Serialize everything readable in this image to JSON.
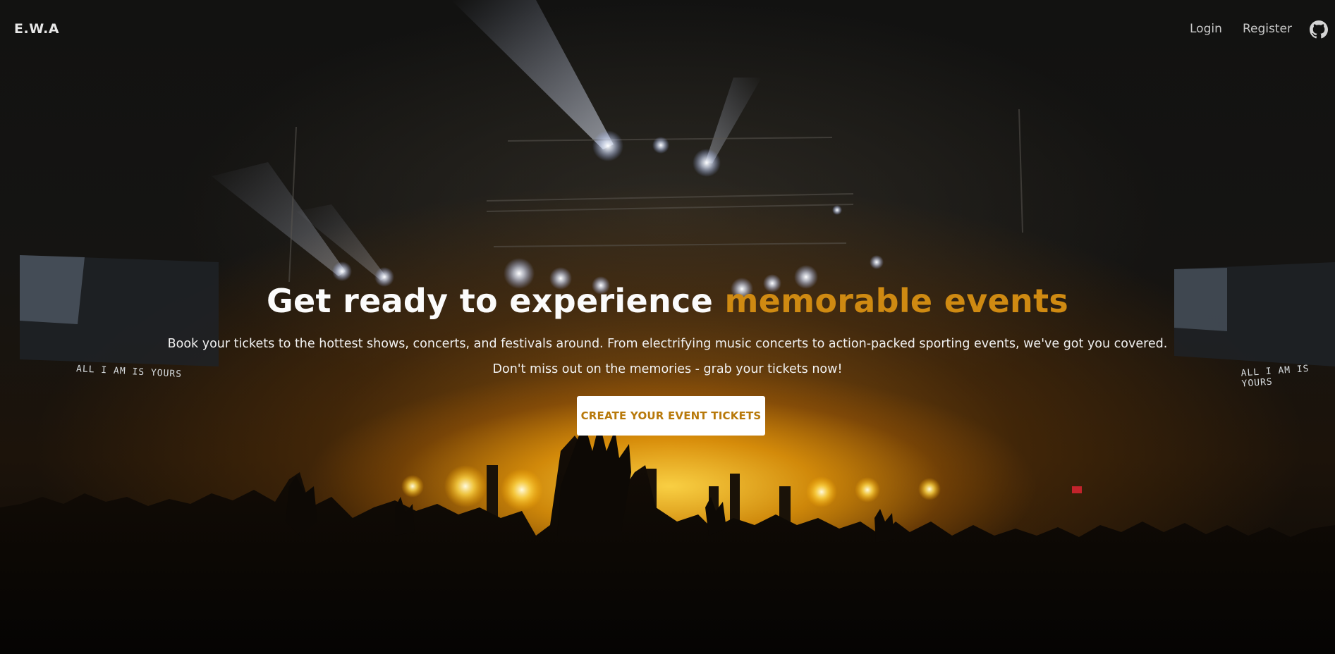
{
  "nav": {
    "brand": "E.W.A",
    "login_label": "Login",
    "register_label": "Register",
    "github_icon": "github-icon"
  },
  "hero": {
    "headline_main": "Get ready to experience ",
    "headline_accent": "memorable events",
    "subtitle_1": "Book your tickets to the hottest shows, concerts, and festivals around. From electrifying music concerts to action-packed sporting events, we've got you covered.",
    "subtitle_2": "Don't miss out on the memories - grab your tickets now!",
    "cta_label": "CREATE YOUR EVENT TICKETS",
    "screen_text_left": "ALL I AM IS YOURS",
    "screen_text_right": "ALL I AM IS YOURS"
  },
  "colors": {
    "accent": "#cf8a12",
    "cta_text": "#b8790b",
    "background": "#121211"
  }
}
